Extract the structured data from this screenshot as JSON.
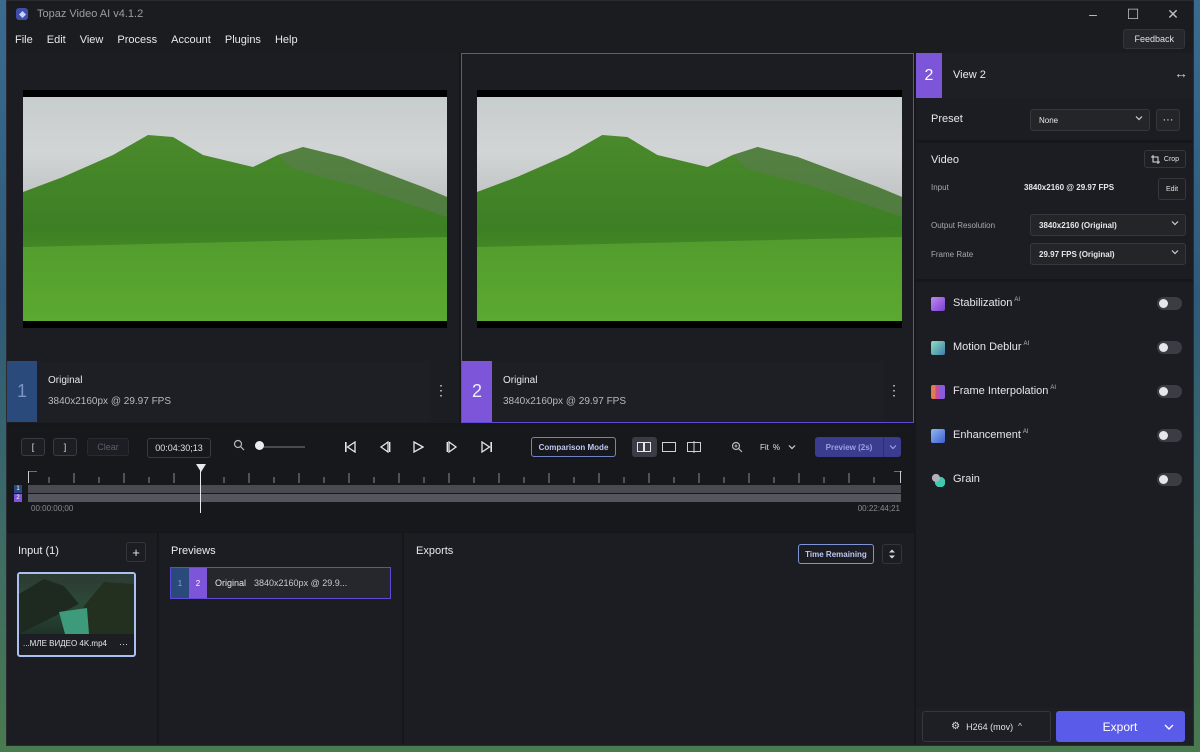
{
  "window": {
    "title": "Topaz Video AI  v4.1.2"
  },
  "menu": [
    "File",
    "Edit",
    "View",
    "Process",
    "Account",
    "Plugins",
    "Help"
  ],
  "feedback_label": "Feedback",
  "viewers": [
    {
      "number": "1",
      "name": "Original",
      "resolution": "3840x2160px @ 29.97 FPS"
    },
    {
      "number": "2",
      "name": "Original",
      "resolution": "3840x2160px @ 29.97 FPS"
    }
  ],
  "transport": {
    "in_mark": "[",
    "out_mark": "]",
    "clear_label": "Clear",
    "timecode": "00:04:30;13",
    "comparison_mode_label": "Comparison Mode",
    "fit_label": "Fit",
    "fit_unit": "%",
    "preview_label": "Preview (2s)"
  },
  "timeline": {
    "start_tc": "00:00:00;00",
    "end_tc": "00:22:44;21",
    "track_labels": [
      "1",
      "2"
    ]
  },
  "input_panel": {
    "title": "Input (1)",
    "add_label": "+",
    "file_name": "...МЛЕ ВИДЕО 4K.mp4",
    "more_label": "···"
  },
  "previews_panel": {
    "title": "Previews",
    "item": {
      "n1": "1",
      "n2": "2",
      "label": "Original",
      "resolution": "3840x2160px @ 29.9..."
    }
  },
  "exports_panel": {
    "title": "Exports",
    "time_remaining_label": "Time Remaining"
  },
  "right_panel": {
    "view_number": "2",
    "view_label": "View 2",
    "preset": {
      "label": "Preset",
      "value": "None"
    },
    "video": {
      "label": "Video",
      "crop_label": "Crop",
      "input_label": "Input",
      "input_value": "3840x2160 @ 29.97 FPS",
      "edit_label": "Edit",
      "output_res_label": "Output Resolution",
      "output_res_value": "3840x2160 (Original)",
      "frame_rate_label": "Frame Rate",
      "frame_rate_value": "29.97 FPS (Original)"
    },
    "features": [
      {
        "label": "Stabilization",
        "ai": "AI",
        "enabled": false,
        "color": "#9a5be0"
      },
      {
        "label": "Motion Deblur",
        "ai": "AI",
        "enabled": false,
        "color": "#4fb39a"
      },
      {
        "label": "Frame Interpolation",
        "ai": "AI",
        "enabled": false,
        "color": "#e0824f"
      },
      {
        "label": "Enhancement",
        "ai": "AI",
        "enabled": false,
        "color": "#4f86e0"
      },
      {
        "label": "Grain",
        "ai": "",
        "enabled": false,
        "color": "#3fc9b0"
      }
    ],
    "codec_label": "H264 (mov)",
    "export_label": "Export"
  },
  "colors": {
    "accent_purple": "#7c55d8",
    "accent_blue": "#2b4a7c",
    "export_button": "#5a5be9"
  }
}
